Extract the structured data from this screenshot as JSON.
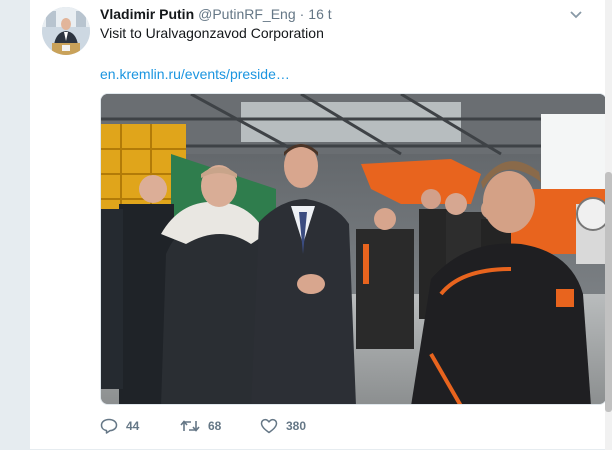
{
  "tweet": {
    "author_name": "Vladimir Putin",
    "handle": "@PutinRF_Eng",
    "separator": "·",
    "time": "16 t",
    "text": "Visit to Uralvagonzavod Corporation",
    "link_text": "en.kremlin.ru/events/preside…"
  },
  "actions": {
    "reply_count": "44",
    "retweet_count": "68",
    "like_count": "380"
  },
  "icons": {
    "reply": "reply-icon",
    "retweet": "retweet-icon",
    "like": "heart-icon",
    "more": "chevron-down-icon"
  },
  "colors": {
    "link": "#1b95e0",
    "secondary_text": "#657786",
    "background": "#e6ecf0"
  }
}
